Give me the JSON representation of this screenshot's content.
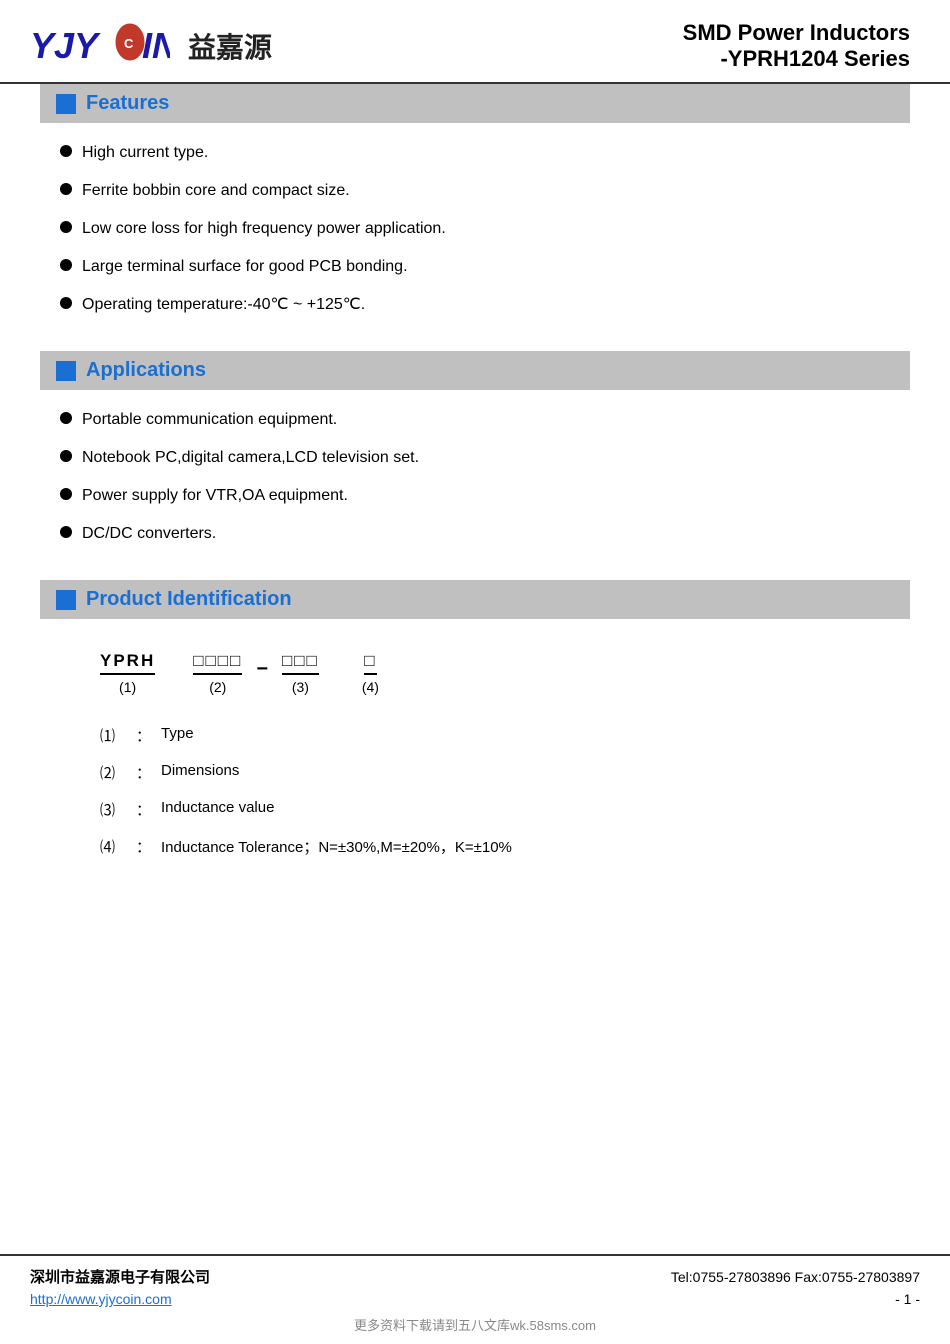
{
  "header": {
    "logo_cn": "益嘉源",
    "title_line1": "SMD Power Inductors",
    "title_line2": "-YPRH1204 Series"
  },
  "features": {
    "section_title": "Features",
    "items": [
      "High current type.",
      "Ferrite bobbin core and compact size.",
      "Low core loss for high frequency power application.",
      "Large terminal surface for good PCB bonding.",
      "Operating temperature:-40℃  ~ +125℃."
    ]
  },
  "applications": {
    "section_title": "Applications",
    "items": [
      "Portable communication equipment.",
      "Notebook PC,digital camera,LCD television set.",
      "Power supply for VTR,OA equipment.",
      "DC/DC converters."
    ]
  },
  "product_id": {
    "section_title": "Product Identification",
    "code_parts": [
      {
        "chars": "YPRH",
        "num": "(1)"
      },
      {
        "chars": "□□□□",
        "num": "(2)"
      },
      {
        "chars": "□□□",
        "num": "(3)"
      },
      {
        "chars": "□",
        "num": "(4)"
      }
    ],
    "dash": "−",
    "descriptions": [
      {
        "num": "⑴",
        "colon": "：",
        "text": "Type"
      },
      {
        "num": "⑵",
        "colon": "：",
        "text": "Dimensions"
      },
      {
        "num": "⑶",
        "colon": "：",
        "text": "Inductance value"
      },
      {
        "num": "⑷",
        "colon": "：",
        "text": "Inductance Tolerance；N=±30%,M=±20%，K=±10%"
      }
    ]
  },
  "footer": {
    "company": "深圳市益嘉源电子有限公司",
    "contact": "Tel:0755-27803896   Fax:0755-27803897",
    "url": "http://www.yjycoin.com",
    "page": "- 1 -",
    "watermark": "更多资料下载请到五八文库wk.58sms.com"
  }
}
